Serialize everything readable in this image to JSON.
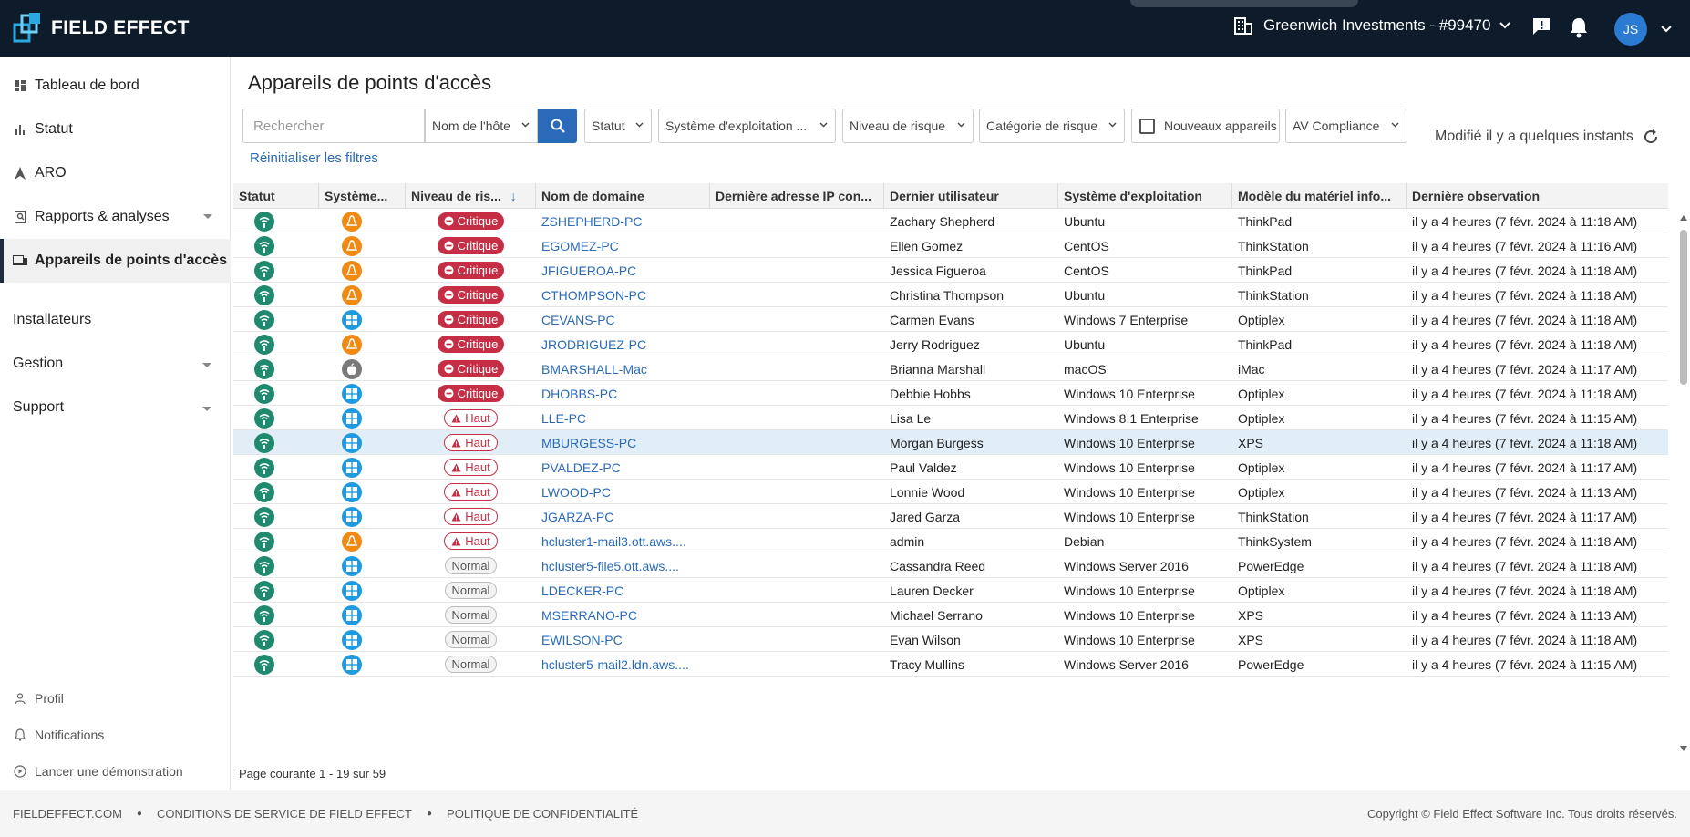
{
  "header": {
    "brand": "FIELD EFFECT",
    "org": "Greenwich Investments - #99470",
    "avatar_initials": "JS",
    "icons": [
      "building-icon",
      "chevron-down-icon",
      "feedback-icon",
      "bell-icon"
    ]
  },
  "sidebar": {
    "items": [
      {
        "label": "Tableau de bord",
        "icon": "dashboard-icon"
      },
      {
        "label": "Statut",
        "icon": "bar-chart-icon"
      },
      {
        "label": "ARO",
        "icon": "aro-icon"
      },
      {
        "label": "Rapports & analyses",
        "icon": "report-search-icon"
      },
      {
        "label": "Appareils de points d'accès",
        "icon": "devices-icon"
      }
    ],
    "plain_items": [
      "Installateurs",
      "Gestion",
      "Support"
    ],
    "bottom_items": [
      {
        "label": "Profil",
        "icon": "person-icon"
      },
      {
        "label": "Notifications",
        "icon": "bell-outline-icon"
      },
      {
        "label": "Lancer une démonstration",
        "icon": "play-circle-icon"
      }
    ]
  },
  "main": {
    "title": "Appareils de points d'accès",
    "search_placeholder": "Rechercher",
    "search_scope": "Nom de l'hôte",
    "filters": {
      "status": "Statut",
      "os": "Système d'exploitation ...",
      "risk_level": "Niveau de risque",
      "risk_category": "Catégorie de risque",
      "new_devices": "Nouveaux appareils",
      "av_compliance": "AV Compliance"
    },
    "reset_filters": "Réinitialiser les filtres",
    "modified": "Modifié il y a quelques instants",
    "pager": "Page courante 1 - 19 sur 59"
  },
  "table": {
    "columns": [
      "Statut",
      "Système...",
      "Niveau de ris...",
      "Nom de domaine",
      "Dernière adresse IP con...",
      "Dernier utilisateur",
      "Système d'exploitation",
      "Modèle du matériel info...",
      "Dernière observation"
    ],
    "rows": [
      {
        "os_icon": "linux",
        "risk": "Critique",
        "risk_type": "crit",
        "domain": "ZSHEPHERD-PC",
        "ip": "",
        "user": "Zachary Shepherd",
        "os": "Ubuntu",
        "model": "ThinkPad",
        "seen": "il y a 4 heures (7 févr. 2024 à 11:18 AM)"
      },
      {
        "os_icon": "linux",
        "risk": "Critique",
        "risk_type": "crit",
        "domain": "EGOMEZ-PC",
        "ip": "",
        "user": "Ellen Gomez",
        "os": "CentOS",
        "model": "ThinkStation",
        "seen": "il y a 4 heures (7 févr. 2024 à 11:16 AM)"
      },
      {
        "os_icon": "linux",
        "risk": "Critique",
        "risk_type": "crit",
        "domain": "JFIGUEROA-PC",
        "ip": "",
        "user": "Jessica Figueroa",
        "os": "CentOS",
        "model": "ThinkPad",
        "seen": "il y a 4 heures (7 févr. 2024 à 11:18 AM)"
      },
      {
        "os_icon": "linux",
        "risk": "Critique",
        "risk_type": "crit",
        "domain": "CTHOMPSON-PC",
        "ip": "",
        "user": "Christina Thompson",
        "os": "Ubuntu",
        "model": "ThinkStation",
        "seen": "il y a 4 heures (7 févr. 2024 à 11:18 AM)"
      },
      {
        "os_icon": "windows",
        "risk": "Critique",
        "risk_type": "crit",
        "domain": "CEVANS-PC",
        "ip": "",
        "user": "Carmen Evans",
        "os": "Windows 7 Enterprise",
        "model": "Optiplex",
        "seen": "il y a 4 heures (7 févr. 2024 à 11:18 AM)"
      },
      {
        "os_icon": "linux",
        "risk": "Critique",
        "risk_type": "crit",
        "domain": "JRODRIGUEZ-PC",
        "ip": "",
        "user": "Jerry Rodriguez",
        "os": "Ubuntu",
        "model": "ThinkPad",
        "seen": "il y a 4 heures (7 févr. 2024 à 11:18 AM)"
      },
      {
        "os_icon": "mac",
        "risk": "Critique",
        "risk_type": "crit",
        "domain": "BMARSHALL-Mac",
        "ip": "",
        "user": "Brianna Marshall",
        "os": "macOS",
        "model": "iMac",
        "seen": "il y a 4 heures (7 févr. 2024 à 11:17 AM)"
      },
      {
        "os_icon": "windows",
        "risk": "Critique",
        "risk_type": "crit",
        "domain": "DHOBBS-PC",
        "ip": "",
        "user": "Debbie Hobbs",
        "os": "Windows 10 Enterprise",
        "model": "Optiplex",
        "seen": "il y a 4 heures (7 févr. 2024 à 11:18 AM)"
      },
      {
        "os_icon": "windows",
        "risk": "Haut",
        "risk_type": "high",
        "domain": "LLE-PC",
        "ip": "",
        "user": "Lisa Le",
        "os": "Windows 8.1 Enterprise",
        "model": "Optiplex",
        "seen": "il y a 4 heures (7 févr. 2024 à 11:15 AM)"
      },
      {
        "os_icon": "windows",
        "risk": "Haut",
        "risk_type": "high",
        "domain": "MBURGESS-PC",
        "ip": "",
        "user": "Morgan Burgess",
        "os": "Windows 10 Enterprise",
        "model": "XPS",
        "seen": "il y a 4 heures (7 févr. 2024 à 11:18 AM)"
      },
      {
        "os_icon": "windows",
        "risk": "Haut",
        "risk_type": "high",
        "domain": "PVALDEZ-PC",
        "ip": "",
        "user": "Paul Valdez",
        "os": "Windows 10 Enterprise",
        "model": "Optiplex",
        "seen": "il y a 4 heures (7 févr. 2024 à 11:17 AM)"
      },
      {
        "os_icon": "windows",
        "risk": "Haut",
        "risk_type": "high",
        "domain": "LWOOD-PC",
        "ip": "",
        "user": "Lonnie Wood",
        "os": "Windows 10 Enterprise",
        "model": "Optiplex",
        "seen": "il y a 4 heures (7 févr. 2024 à 11:13 AM)"
      },
      {
        "os_icon": "windows",
        "risk": "Haut",
        "risk_type": "high",
        "domain": "JGARZA-PC",
        "ip": "",
        "user": "Jared Garza",
        "os": "Windows 10 Enterprise",
        "model": "ThinkStation",
        "seen": "il y a 4 heures (7 févr. 2024 à 11:17 AM)"
      },
      {
        "os_icon": "linux",
        "risk": "Haut",
        "risk_type": "high",
        "domain": "hcluster1-mail3.ott.aws....",
        "ip": "",
        "user": "admin",
        "os": "Debian",
        "model": "ThinkSystem",
        "seen": "il y a 4 heures (7 févr. 2024 à 11:18 AM)"
      },
      {
        "os_icon": "windows",
        "risk": "Normal",
        "risk_type": "norm",
        "domain": "hcluster5-file5.ott.aws....",
        "ip": "",
        "user": "Cassandra Reed",
        "os": "Windows Server 2016",
        "model": "PowerEdge",
        "seen": "il y a 4 heures (7 févr. 2024 à 11:18 AM)"
      },
      {
        "os_icon": "windows",
        "risk": "Normal",
        "risk_type": "norm",
        "domain": "LDECKER-PC",
        "ip": "",
        "user": "Lauren Decker",
        "os": "Windows 10 Enterprise",
        "model": "Optiplex",
        "seen": "il y a 4 heures (7 févr. 2024 à 11:18 AM)"
      },
      {
        "os_icon": "windows",
        "risk": "Normal",
        "risk_type": "norm",
        "domain": "MSERRANO-PC",
        "ip": "",
        "user": "Michael Serrano",
        "os": "Windows 10 Enterprise",
        "model": "XPS",
        "seen": "il y a 4 heures (7 févr. 2024 à 11:13 AM)"
      },
      {
        "os_icon": "windows",
        "risk": "Normal",
        "risk_type": "norm",
        "domain": "EWILSON-PC",
        "ip": "",
        "user": "Evan Wilson",
        "os": "Windows 10 Enterprise",
        "model": "XPS",
        "seen": "il y a 4 heures (7 févr. 2024 à 11:18 AM)"
      },
      {
        "os_icon": "windows",
        "risk": "Normal",
        "risk_type": "norm",
        "domain": "hcluster5-mail2.ldn.aws....",
        "ip": "",
        "user": "Tracy Mullins",
        "os": "Windows Server 2016",
        "model": "PowerEdge",
        "seen": "il y a 4 heures (7 févr. 2024 à 11:15 AM)"
      }
    ]
  },
  "footer": {
    "links": [
      "FIELDEFFECT.COM",
      "CONDITIONS DE SERVICE DE FIELD EFFECT",
      "POLITIQUE DE CONFIDENTIALITÉ"
    ],
    "copyright": "Copyright © Field Effect Software Inc. Tous droits réservés."
  },
  "colors": {
    "topbar": "#0e1b2b",
    "accent": "#2a6ab8",
    "critical": "#c62e46",
    "status_ok": "#1f8a6e",
    "linux": "#f08a12",
    "windows": "#1f9ae0",
    "mac": "#7a7a7a",
    "highlight_row": "#e1edf7"
  }
}
